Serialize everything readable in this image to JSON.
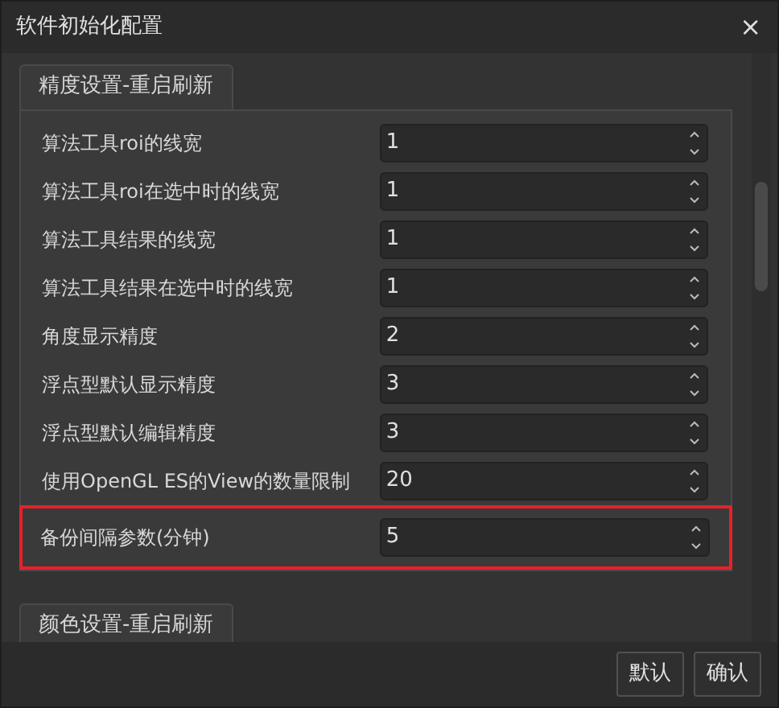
{
  "window": {
    "title": "软件初始化配置",
    "close": "×"
  },
  "groups": [
    {
      "title": "精度设置-重启刷新",
      "rows": [
        {
          "label": "算法工具roi的线宽",
          "value": "1",
          "highlighted": false
        },
        {
          "label": "算法工具roi在选中时的线宽",
          "value": "1",
          "highlighted": false
        },
        {
          "label": "算法工具结果的线宽",
          "value": "1",
          "highlighted": false
        },
        {
          "label": "算法工具结果在选中时的线宽",
          "value": "1",
          "highlighted": false
        },
        {
          "label": "角度显示精度",
          "value": "2",
          "highlighted": false
        },
        {
          "label": "浮点型默认显示精度",
          "value": "3",
          "highlighted": false
        },
        {
          "label": "浮点型默认编辑精度",
          "value": "3",
          "highlighted": false
        },
        {
          "label": "使用OpenGL ES的View的数量限制",
          "value": "20",
          "highlighted": false
        },
        {
          "label": "备份间隔参数(分钟)",
          "value": "5",
          "highlighted": true
        }
      ]
    },
    {
      "title": "颜色设置-重启刷新"
    }
  ],
  "buttons": [
    "默认",
    "确认"
  ]
}
